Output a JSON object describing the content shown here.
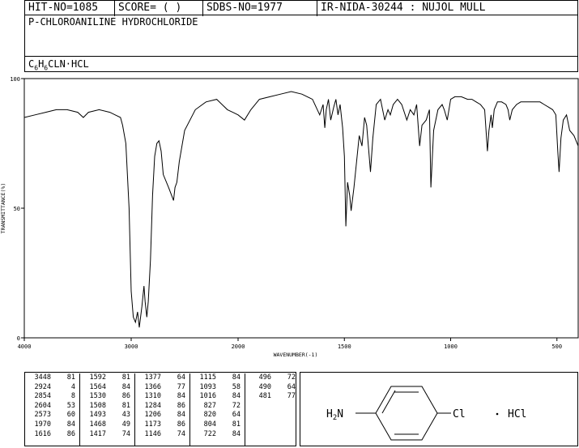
{
  "header": {
    "hit_no": "HIT-NO=1085",
    "score": "SCORE=  (   )",
    "sdbs_no": "SDBS-NO=1977",
    "method": "IR-NIDA-30244 : NUJOL MULL"
  },
  "compound": {
    "name": "P-CHLOROANILINE HYDROCHLORIDE"
  },
  "structure": {
    "left_group": "H2N",
    "right_group": "Cl",
    "salt": "HCl"
  },
  "chart_data": {
    "type": "line",
    "xlabel": "WAVENUMBER(-1)",
    "ylabel": "TRANSMITTANCE(%)",
    "xlim": [
      4000,
      400
    ],
    "ylim": [
      0,
      100
    ],
    "x_ticks": [
      "4000",
      "3000",
      "2000",
      "1500",
      "1000",
      "500"
    ],
    "y_ticks": [
      "0",
      "50",
      "100"
    ],
    "series": [
      {
        "x": [
          4000,
          3900,
          3800,
          3700,
          3600,
          3500,
          3448,
          3400,
          3300,
          3200,
          3150,
          3100,
          3080,
          3050,
          3020,
          3000,
          2980,
          2960,
          2940,
          2924,
          2900,
          2880,
          2870,
          2854,
          2840,
          2820,
          2800,
          2780,
          2760,
          2740,
          2720,
          2700,
          2650,
          2604,
          2590,
          2573,
          2550,
          2500,
          2400,
          2300,
          2200,
          2100,
          2050,
          2000,
          1970,
          1940,
          1900,
          1850,
          1800,
          1750,
          1700,
          1650,
          1616,
          1600,
          1592,
          1585,
          1575,
          1564,
          1550,
          1540,
          1530,
          1520,
          1508,
          1500,
          1493,
          1485,
          1475,
          1468,
          1455,
          1440,
          1430,
          1417,
          1405,
          1395,
          1377,
          1366,
          1350,
          1330,
          1310,
          1295,
          1284,
          1270,
          1250,
          1230,
          1206,
          1190,
          1173,
          1160,
          1146,
          1135,
          1115,
          1100,
          1093,
          1080,
          1060,
          1040,
          1030,
          1016,
          1000,
          980,
          950,
          920,
          900,
          880,
          860,
          840,
          827,
          820,
          810,
          804,
          795,
          780,
          760,
          740,
          730,
          722,
          710,
          690,
          670,
          650,
          620,
          600,
          580,
          560,
          540,
          520,
          505,
          496,
          490,
          481,
          470,
          455,
          440,
          420,
          400
        ],
        "y": [
          85,
          86,
          87,
          88,
          88,
          87,
          85,
          87,
          88,
          87,
          86,
          85,
          82,
          75,
          50,
          18,
          8,
          6,
          10,
          4,
          12,
          20,
          14,
          8,
          14,
          30,
          55,
          70,
          75,
          76,
          72,
          63,
          58,
          53,
          58,
          60,
          68,
          80,
          88,
          91,
          92,
          88,
          87,
          86,
          84,
          88,
          92,
          93,
          94,
          95,
          94,
          92,
          86,
          90,
          81,
          88,
          92,
          84,
          89,
          92,
          86,
          90,
          81,
          70,
          43,
          60,
          55,
          49,
          58,
          70,
          78,
          74,
          85,
          82,
          64,
          77,
          90,
          92,
          84,
          88,
          86,
          90,
          92,
          90,
          84,
          88,
          86,
          90,
          74,
          82,
          84,
          88,
          58,
          80,
          88,
          90,
          88,
          84,
          92,
          93,
          93,
          92,
          92,
          91,
          90,
          88,
          72,
          80,
          86,
          81,
          88,
          91,
          91,
          90,
          88,
          84,
          88,
          90,
          91,
          91,
          91,
          91,
          91,
          90,
          89,
          88,
          86,
          72,
          64,
          77,
          84,
          86,
          80,
          78,
          74
        ]
      }
    ],
    "peaks": [
      {
        "wn": "3448",
        "t": "81"
      },
      {
        "wn": "2924",
        "t": "4"
      },
      {
        "wn": "2854",
        "t": "8"
      },
      {
        "wn": "2604",
        "t": "53"
      },
      {
        "wn": "2573",
        "t": "60"
      },
      {
        "wn": "1970",
        "t": "84"
      },
      {
        "wn": "1616",
        "t": "86"
      },
      {
        "wn": "1592",
        "t": "81"
      },
      {
        "wn": "1564",
        "t": "84"
      },
      {
        "wn": "1530",
        "t": "86"
      },
      {
        "wn": "1508",
        "t": "81"
      },
      {
        "wn": "1493",
        "t": "43"
      },
      {
        "wn": "1468",
        "t": "49"
      },
      {
        "wn": "1417",
        "t": "74"
      },
      {
        "wn": "1377",
        "t": "64"
      },
      {
        "wn": "1366",
        "t": "77"
      },
      {
        "wn": "1310",
        "t": "84"
      },
      {
        "wn": "1284",
        "t": "86"
      },
      {
        "wn": "1206",
        "t": "84"
      },
      {
        "wn": "1173",
        "t": "86"
      },
      {
        "wn": "1146",
        "t": "74"
      },
      {
        "wn": "1115",
        "t": "84"
      },
      {
        "wn": "1093",
        "t": "58"
      },
      {
        "wn": "1016",
        "t": "84"
      },
      {
        "wn": "827",
        "t": "72"
      },
      {
        "wn": "820",
        "t": "64"
      },
      {
        "wn": "804",
        "t": "81"
      },
      {
        "wn": "722",
        "t": "84"
      },
      {
        "wn": "496",
        "t": "72"
      },
      {
        "wn": "490",
        "t": "64"
      },
      {
        "wn": "481",
        "t": "77"
      }
    ]
  }
}
